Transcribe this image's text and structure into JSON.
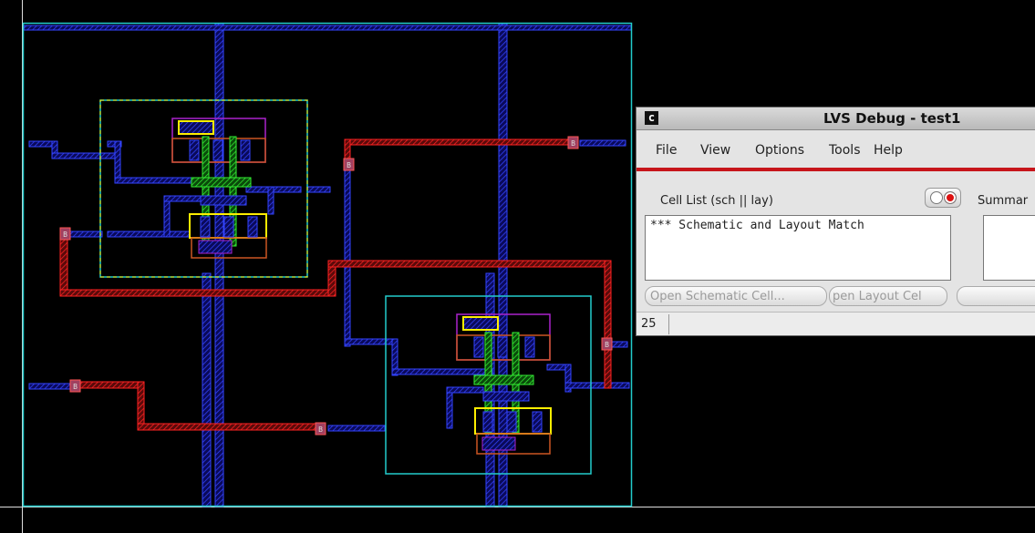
{
  "layout_editor": {
    "pin_labels": [
      "B",
      "B",
      "B",
      "B",
      "B",
      "B"
    ]
  },
  "lvs_window": {
    "title": "LVS Debug - test1",
    "icon_glyph": "c",
    "menu": [
      "File",
      "View",
      "Options",
      "Tools",
      "Help"
    ],
    "cell_list_label": "Cell List (sch || lay)",
    "summary_label": "Summar",
    "cell_list_items": [
      "*** Schematic and Layout Match"
    ],
    "buttons": {
      "open_schematic": "Open Schematic Cell...",
      "open_layout": "pen Layout Cel"
    },
    "status_number": "25"
  },
  "colors": {
    "metal_blue": "#2233ee",
    "metal_red": "#ee2222",
    "poly_green": "#22dd22",
    "cell_yellow": "#ffee00",
    "boundary_cyan": "#22cccc",
    "purple": "#aa22cc",
    "brown": "#cc5522"
  }
}
